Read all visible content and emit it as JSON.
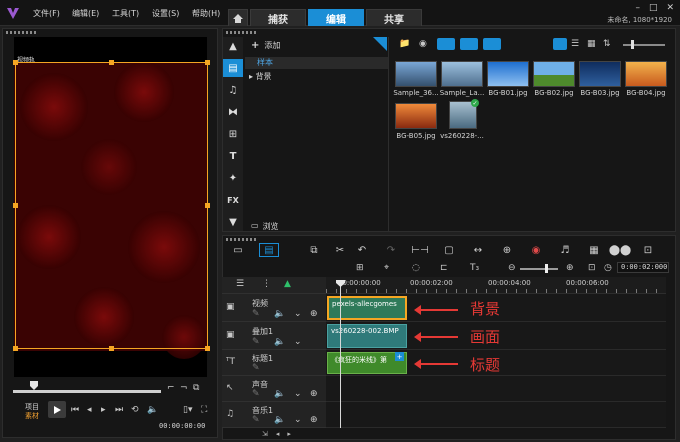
{
  "menu": [
    "文件(F)",
    "编辑(E)",
    "工具(T)",
    "设置(S)",
    "帮助(H)"
  ],
  "tabs": [
    {
      "label": "捕获"
    },
    {
      "label": "编辑",
      "active": true
    },
    {
      "label": "共享"
    }
  ],
  "project_info": "未命名, 1080*1920",
  "preview": {
    "caption": "视频轨",
    "mode_project": "项目",
    "mode_clip": "素材",
    "timecode": "00:00:00:00"
  },
  "library": {
    "add_label": "添加",
    "folders": [
      {
        "label": "样本",
        "selected": true
      },
      {
        "label": "背景",
        "selected": false
      }
    ],
    "browse_label": "浏览",
    "media": [
      {
        "name": "Sample_36...",
        "color": "#3d6ea8"
      },
      {
        "name": "Sample_La...",
        "color": "#5a7fa8"
      },
      {
        "name": "BG-B01.jpg",
        "color": "#2a7ad6"
      },
      {
        "name": "BG-B02.jpg",
        "color": "#5b9a3a"
      },
      {
        "name": "BG-B03.jpg",
        "color": "#1e4e8a"
      },
      {
        "name": "BG-B04.jpg",
        "color": "#e08a3a"
      },
      {
        "name": "BG-B05.jpg",
        "color": "#c8501e"
      },
      {
        "name": "vs260228-...",
        "color": "#6a8aa0"
      }
    ]
  },
  "timeline": {
    "ruler": [
      "00:00:00:00",
      "00:00:02:00",
      "00:00:04:00",
      "00:00:06:00"
    ],
    "timecode": "0:00:02:000",
    "zoom_label": "",
    "tracks": [
      {
        "name": "视频",
        "type": "video"
      },
      {
        "name": "叠加1",
        "type": "overlay"
      },
      {
        "name": "标题1",
        "type": "title"
      },
      {
        "name": "声音",
        "type": "voice"
      },
      {
        "name": "音乐1",
        "type": "music"
      }
    ],
    "clips": [
      {
        "track": "video",
        "label": "pexels-allecgomes"
      },
      {
        "track": "overlay",
        "label": "vs260228-002.BMP"
      },
      {
        "track": "title",
        "label": "《疯狂的米线》第"
      }
    ]
  },
  "annotations": [
    "背景",
    "画面",
    "标题"
  ]
}
